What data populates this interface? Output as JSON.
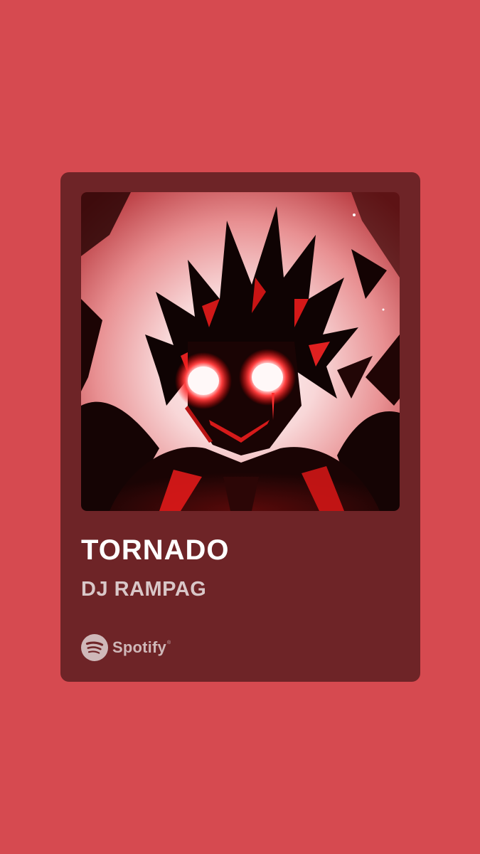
{
  "theme": {
    "background": "#d64a50",
    "card": "#6e2427",
    "title_color": "#ffffff",
    "artist_color": "#d9c7c8",
    "brand_color": "#cfb8b9",
    "cover_dark": "#140505",
    "cover_glow": "#ff1a1a",
    "cover_light": "#fff1f1"
  },
  "track": {
    "title": "TORNADO",
    "artist": "DJ RAMPAG"
  },
  "cover": {
    "icon": "anime-character-glowing-eyes-artwork"
  },
  "brand": {
    "name": "Spotify",
    "icon": "spotify-logo-icon"
  }
}
